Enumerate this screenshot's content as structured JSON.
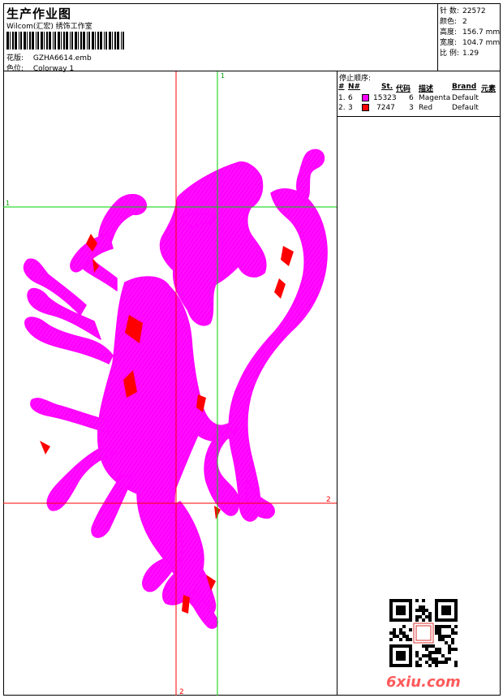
{
  "header": {
    "title": "生产作业图",
    "company": "Wilcom(汇宏) 绣饰工作室",
    "design_label": "花版:",
    "design_value": "GZHA6614.emb",
    "colorway_label": "色位:",
    "colorway_value": "Colorway 1"
  },
  "stats": {
    "stitches_label": "针 数:",
    "stitches_value": "22572",
    "colors_label": "颜色:",
    "colors_value": "2",
    "height_label": "高度:",
    "height_value": "156.7 mm",
    "width_label": "宽度:",
    "width_value": "104.7 mm",
    "scale_label": "比 例:",
    "scale_value": "1.29"
  },
  "stop_sequence": {
    "title": "停止顺序:",
    "columns": [
      "#",
      "N#",
      "St.",
      "代码",
      "描述",
      "Brand",
      "元素"
    ],
    "rows": [
      {
        "num": "1.",
        "n": "6",
        "stitches": "15323",
        "code": "6",
        "description": "Magenta",
        "brand": "Default",
        "color": "#ff00ff"
      },
      {
        "num": "2.",
        "n": "3",
        "stitches": "7247",
        "code": "3",
        "description": "Red",
        "brand": "Default",
        "color": "#ff0000"
      }
    ]
  },
  "guides": {
    "top_label": "1",
    "left_label": "1",
    "right_label": "2",
    "bottom_label": "2"
  },
  "watermark": "6xiu.com",
  "colors": {
    "magenta": "#ff00ff",
    "red": "#ff0000",
    "green": "#00d000",
    "guide_red": "#ff0000"
  }
}
